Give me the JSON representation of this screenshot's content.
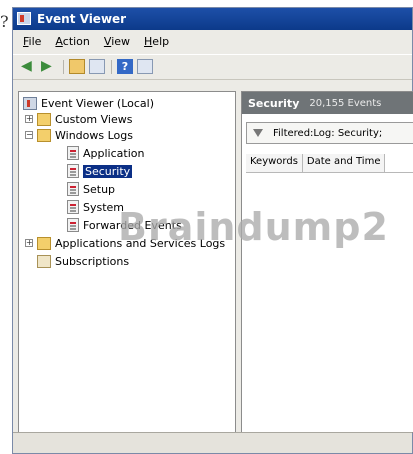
{
  "page": {
    "question_mark": "?"
  },
  "window": {
    "title": "Event Viewer"
  },
  "menu": [
    "File",
    "Action",
    "View",
    "Help"
  ],
  "toolbar": {
    "buttons": [
      "back-arrow",
      "forward-arrow",
      "up-folder",
      "properties",
      "help",
      "show-hide-pane"
    ]
  },
  "tree": {
    "root": "Event Viewer (Local)",
    "custom_views": "Custom Views",
    "windows_logs": "Windows Logs",
    "logs": [
      "Application",
      "Security",
      "Setup",
      "System",
      "Forwarded Events"
    ],
    "selected": "Security",
    "apps_services": "Applications and Services Logs",
    "subscriptions": "Subscriptions"
  },
  "right_pane": {
    "title": "Security",
    "count": "20,155 Events",
    "filter_text": "Filtered:Log: Security;",
    "columns": [
      "Keywords",
      "Date and Time"
    ]
  },
  "watermark": "Braindump2"
}
